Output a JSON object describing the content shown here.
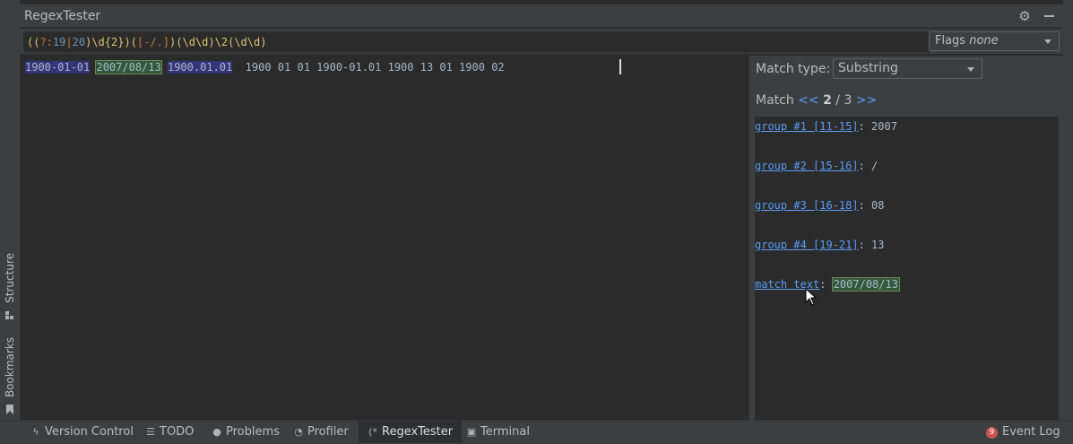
{
  "window": {
    "title": "RegexTester"
  },
  "regex": {
    "parts": [
      {
        "t": "(",
        "k": "p"
      },
      {
        "t": "(",
        "k": "p"
      },
      {
        "t": "?:",
        "k": "c"
      },
      {
        "t": "19",
        "k": "num"
      },
      {
        "t": "|",
        "k": "c"
      },
      {
        "t": "20",
        "k": "num"
      },
      {
        "t": ")",
        "k": "p"
      },
      {
        "t": "\\d",
        "k": "p"
      },
      {
        "t": "{2}",
        "k": "p"
      },
      {
        "t": ")",
        "k": "p"
      },
      {
        "t": "(",
        "k": "p"
      },
      {
        "t": "[-/.]",
        "k": "c"
      },
      {
        "t": ")",
        "k": "p"
      },
      {
        "t": "(",
        "k": "p"
      },
      {
        "t": "\\d\\d",
        "k": "p"
      },
      {
        "t": ")",
        "k": "p"
      },
      {
        "t": "\\2",
        "k": "p"
      },
      {
        "t": "(",
        "k": "p"
      },
      {
        "t": "\\d\\d",
        "k": "p"
      },
      {
        "t": ")",
        "k": "p"
      }
    ],
    "full": "((?:19|20)\\d{2})([-/.])(\\d\\d)\\2(\\d\\d)"
  },
  "flags": {
    "label": "Flags",
    "value": "none"
  },
  "test_text": {
    "match1": "1900-01-01",
    "sep1": " ",
    "match2": "2007/08/13",
    "sep2": " ",
    "match3": "1900.01.01",
    "rest": "  1900 01 01 1900-01.01 1900 13 01 1900 02"
  },
  "match_panel": {
    "match_type_label": "Match type:",
    "match_type_value": "Substring",
    "match_label": "Match",
    "prev": "<<",
    "current": "2",
    "total": "/ 3",
    "next": ">>"
  },
  "groups": [
    {
      "link": "group #1 [11-15]",
      "value": "2007"
    },
    {
      "link": "group #2 [15-16]",
      "value": "/"
    },
    {
      "link": "group #3 [16-18]",
      "value": "08"
    },
    {
      "link": "group #4 [19-21]",
      "value": "13"
    }
  ],
  "match_text": {
    "link": "match text",
    "value": "2007/08/13"
  },
  "left_tabs": {
    "structure": "Structure",
    "bookmarks": "Bookmarks"
  },
  "bottom_tabs": {
    "version_control": "Version Control",
    "todo": "TODO",
    "problems": "Problems",
    "profiler": "Profiler",
    "regextester": "RegexTester",
    "terminal": "Terminal",
    "event_log": "Event Log",
    "event_count": "9"
  },
  "colors": {
    "accent_link": "#589df6",
    "match_bg": "#33357a",
    "current_match_bg": "#32593d"
  }
}
